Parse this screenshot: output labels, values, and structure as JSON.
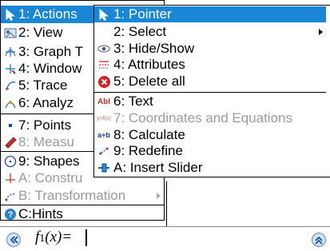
{
  "main_menu": {
    "items": [
      {
        "label": "1: Actions",
        "icon": "pointer-icon",
        "selected": true,
        "disabled": false
      },
      {
        "label": "2: View",
        "icon": "view-icon",
        "selected": false,
        "disabled": false
      },
      {
        "label": "3: Graph T",
        "icon": "graph-type-icon",
        "selected": false,
        "disabled": false
      },
      {
        "label": "4: Window",
        "icon": "window-icon",
        "selected": false,
        "disabled": false
      },
      {
        "label": "5: Trace",
        "icon": "trace-icon",
        "selected": false,
        "disabled": false
      },
      {
        "label": "6: Analyz",
        "icon": "analyze-icon",
        "selected": false,
        "disabled": false
      },
      {
        "label": "7: Points",
        "icon": "points-icon",
        "selected": false,
        "disabled": false
      },
      {
        "label": "8: Measu",
        "icon": "measure-icon",
        "selected": false,
        "disabled": true
      },
      {
        "label": "9: Shapes",
        "icon": "shapes-icon",
        "selected": false,
        "disabled": false
      },
      {
        "label": "A: Constru",
        "icon": "construction-icon",
        "selected": false,
        "disabled": true
      },
      {
        "label": "B: Transformation",
        "icon": "transformation-icon",
        "selected": false,
        "disabled": true
      },
      {
        "label": "C:Hints",
        "icon": "hints-icon",
        "selected": false,
        "disabled": false
      }
    ]
  },
  "sub_menu": {
    "items": [
      {
        "label": "1: Pointer",
        "icon": "pointer-icon",
        "selected": true,
        "disabled": false
      },
      {
        "label": "2: Select",
        "icon": "",
        "selected": false,
        "disabled": false
      },
      {
        "label": "3: Hide/Show",
        "icon": "eye-icon",
        "selected": false,
        "disabled": false
      },
      {
        "label": "4: Attributes",
        "icon": "attributes-icon",
        "selected": false,
        "disabled": false
      },
      {
        "label": "5: Delete all",
        "icon": "delete-icon",
        "selected": false,
        "disabled": false
      },
      {
        "label": "6: Text",
        "icon": "text-icon",
        "selected": false,
        "disabled": false
      },
      {
        "label": "7: Coordinates and Equations",
        "icon": "coordinates-icon",
        "selected": false,
        "disabled": true
      },
      {
        "label": "8: Calculate",
        "icon": "calculate-icon",
        "selected": false,
        "disabled": false
      },
      {
        "label": "9: Redefine",
        "icon": "redefine-icon",
        "selected": false,
        "disabled": false
      },
      {
        "label": "A: Insert Slider",
        "icon": "slider-icon",
        "selected": false,
        "disabled": false
      }
    ]
  },
  "icons": {
    "text_icon_glyph": "AbI",
    "calculate_icon_glyph": "a+b",
    "coordinates_icon_glyph": "y=f(x)"
  },
  "entry_line": {
    "label": "f1(x)=",
    "label_fn": "f",
    "label_sub": "1",
    "label_rest": "(x)="
  },
  "colors": {
    "selection": "#1a86d6",
    "disabled_text": "#9a9a9a"
  }
}
